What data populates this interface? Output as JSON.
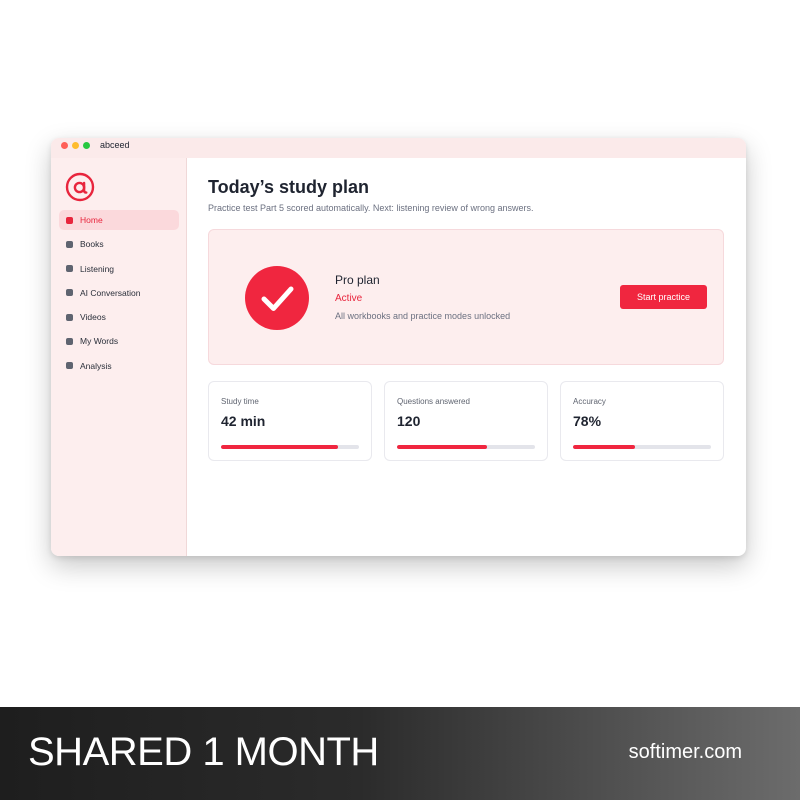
{
  "window": {
    "title": "abceed",
    "traffic_lights": [
      "#ff5f57",
      "#febc2e",
      "#28c840"
    ]
  },
  "sidebar": {
    "logo_icon": "abceed-logo-icon",
    "items": [
      {
        "label": "Home",
        "active": true
      },
      {
        "label": "Books",
        "active": false
      },
      {
        "label": "Listening",
        "active": false
      },
      {
        "label": "AI Conversation",
        "active": false
      },
      {
        "label": "Videos",
        "active": false
      },
      {
        "label": "My Words",
        "active": false
      },
      {
        "label": "Analysis",
        "active": false
      }
    ]
  },
  "main": {
    "title": "Today’s study plan",
    "subtitle": "Practice test Part 5 scored automatically. Next: listening review of wrong answers.",
    "plan": {
      "icon": "checkmark-circle-icon",
      "name": "Pro plan",
      "status": "Active",
      "description": "All workbooks and practice modes unlocked",
      "button_label": "Start practice"
    },
    "stats": [
      {
        "label": "Study time",
        "value": "42 min",
        "progress": 0.85
      },
      {
        "label": "Questions answered",
        "value": "120",
        "progress": 0.65
      },
      {
        "label": "Accuracy",
        "value": "78%",
        "progress": 0.45
      }
    ]
  },
  "banner": {
    "title": "SHARED 1 MONTH",
    "site": "softimer.com"
  },
  "colors": {
    "accent": "#f0263f",
    "sidebar_bg": "#fdeeee",
    "active_item_bg": "#fbd9dc"
  }
}
